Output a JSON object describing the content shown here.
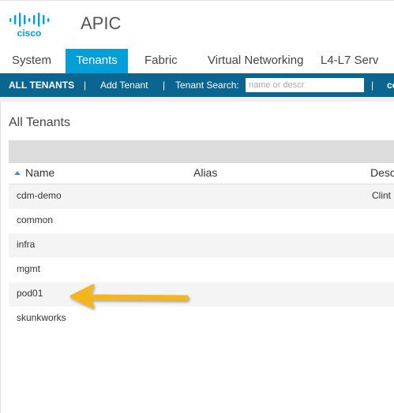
{
  "header": {
    "brand": "cisco",
    "app_title": "APIC",
    "logo_icon": "cisco-logo",
    "accent_color": "#049fd9"
  },
  "top_nav": {
    "tabs": [
      {
        "label": "System",
        "active": false
      },
      {
        "label": "Tenants",
        "active": true
      },
      {
        "label": "Fabric",
        "active": false
      },
      {
        "label": "Virtual Networking",
        "active": false
      },
      {
        "label": "L4-L7 Serv",
        "active": false
      }
    ]
  },
  "sub_nav": {
    "all_tenants": "ALL TENANTS",
    "separator": "|",
    "add_tenant": "Add Tenant",
    "search_label": "Tenant Search:",
    "search_placeholder": "name or descr",
    "more": "co",
    "bg_color": "#0a6690"
  },
  "main": {
    "title": "All Tenants",
    "table": {
      "columns": [
        "Name",
        "Alias",
        "Desc"
      ],
      "sort_column": "Name",
      "rows": [
        {
          "name": "cdm-demo",
          "alias": "",
          "desc": "Clint"
        },
        {
          "name": "common",
          "alias": "",
          "desc": ""
        },
        {
          "name": "infra",
          "alias": "",
          "desc": ""
        },
        {
          "name": "mgmt",
          "alias": "",
          "desc": ""
        },
        {
          "name": "pod01",
          "alias": "",
          "desc": ""
        },
        {
          "name": "skunkworks",
          "alias": "",
          "desc": ""
        }
      ]
    }
  },
  "annotation": {
    "icon": "arrow-left-icon",
    "color": "#f5b51a",
    "points_to": "pod01"
  }
}
